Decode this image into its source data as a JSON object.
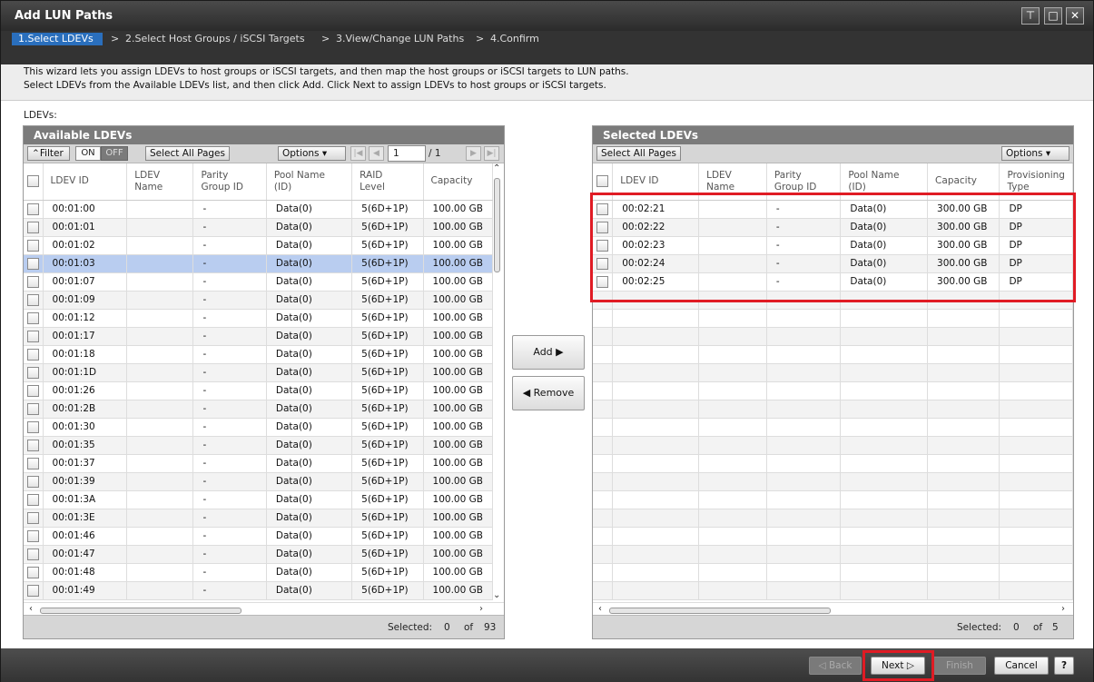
{
  "window": {
    "title": "Add LUN Paths"
  },
  "steps": [
    {
      "label": "1.Select LDEVs",
      "active": true
    },
    {
      "label": "2.Select Host Groups / iSCSI Targets"
    },
    {
      "label": "3.View/Change LUN Paths"
    },
    {
      "label": "4.Confirm"
    }
  ],
  "step_separator": ">",
  "intro": {
    "line1": "This wizard lets you assign LDEVs to host groups or iSCSI targets, and then map the host groups or iSCSI targets to LUN paths.",
    "line2": "Select LDEVs from the Available LDEVs list, and then click Add. Click Next to assign LDEVs to host groups or iSCSI targets."
  },
  "ldevs_label": "LDEVs:",
  "available": {
    "title": "Available LDEVs",
    "filter_label": "Filter",
    "toggle_on": "ON",
    "toggle_off": "OFF",
    "select_all_pages": "Select All Pages",
    "options_label": "Options",
    "page_value": "1",
    "page_total": "/ 1",
    "columns": [
      "LDEV ID",
      "LDEV\nName",
      "Parity\nGroup ID",
      "Pool Name\n(ID)",
      "RAID\nLevel",
      "Capacity"
    ],
    "rows": [
      [
        "00:01:00",
        "",
        "-",
        "Data(0)",
        "5(6D+1P)",
        "100.00 GB"
      ],
      [
        "00:01:01",
        "",
        "-",
        "Data(0)",
        "5(6D+1P)",
        "100.00 GB"
      ],
      [
        "00:01:02",
        "",
        "-",
        "Data(0)",
        "5(6D+1P)",
        "100.00 GB"
      ],
      [
        "00:01:03",
        "",
        "-",
        "Data(0)",
        "5(6D+1P)",
        "100.00 GB"
      ],
      [
        "00:01:07",
        "",
        "-",
        "Data(0)",
        "5(6D+1P)",
        "100.00 GB"
      ],
      [
        "00:01:09",
        "",
        "-",
        "Data(0)",
        "5(6D+1P)",
        "100.00 GB"
      ],
      [
        "00:01:12",
        "",
        "-",
        "Data(0)",
        "5(6D+1P)",
        "100.00 GB"
      ],
      [
        "00:01:17",
        "",
        "-",
        "Data(0)",
        "5(6D+1P)",
        "100.00 GB"
      ],
      [
        "00:01:18",
        "",
        "-",
        "Data(0)",
        "5(6D+1P)",
        "100.00 GB"
      ],
      [
        "00:01:1D",
        "",
        "-",
        "Data(0)",
        "5(6D+1P)",
        "100.00 GB"
      ],
      [
        "00:01:26",
        "",
        "-",
        "Data(0)",
        "5(6D+1P)",
        "100.00 GB"
      ],
      [
        "00:01:2B",
        "",
        "-",
        "Data(0)",
        "5(6D+1P)",
        "100.00 GB"
      ],
      [
        "00:01:30",
        "",
        "-",
        "Data(0)",
        "5(6D+1P)",
        "100.00 GB"
      ],
      [
        "00:01:35",
        "",
        "-",
        "Data(0)",
        "5(6D+1P)",
        "100.00 GB"
      ],
      [
        "00:01:37",
        "",
        "-",
        "Data(0)",
        "5(6D+1P)",
        "100.00 GB"
      ],
      [
        "00:01:39",
        "",
        "-",
        "Data(0)",
        "5(6D+1P)",
        "100.00 GB"
      ],
      [
        "00:01:3A",
        "",
        "-",
        "Data(0)",
        "5(6D+1P)",
        "100.00 GB"
      ],
      [
        "00:01:3E",
        "",
        "-",
        "Data(0)",
        "5(6D+1P)",
        "100.00 GB"
      ],
      [
        "00:01:46",
        "",
        "-",
        "Data(0)",
        "5(6D+1P)",
        "100.00 GB"
      ],
      [
        "00:01:47",
        "",
        "-",
        "Data(0)",
        "5(6D+1P)",
        "100.00 GB"
      ],
      [
        "00:01:48",
        "",
        "-",
        "Data(0)",
        "5(6D+1P)",
        "100.00 GB"
      ],
      [
        "00:01:49",
        "",
        "-",
        "Data(0)",
        "5(6D+1P)",
        "100.00 GB"
      ]
    ],
    "selected_row_index": 3,
    "footer_selected_label": "Selected:",
    "footer_selected_count": "0",
    "footer_of": "of",
    "footer_total": "93"
  },
  "buttons": {
    "add": "Add",
    "remove": "Remove"
  },
  "selected": {
    "title": "Selected LDEVs",
    "select_all_pages": "Select All Pages",
    "options_label": "Options",
    "columns": [
      "LDEV ID",
      "LDEV\nName",
      "Parity\nGroup ID",
      "Pool Name\n(ID)",
      "Capacity",
      "Provisioning\nType"
    ],
    "rows": [
      [
        "00:02:21",
        "",
        "-",
        "Data(0)",
        "300.00 GB",
        "DP"
      ],
      [
        "00:02:22",
        "",
        "-",
        "Data(0)",
        "300.00 GB",
        "DP"
      ],
      [
        "00:02:23",
        "",
        "-",
        "Data(0)",
        "300.00 GB",
        "DP"
      ],
      [
        "00:02:24",
        "",
        "-",
        "Data(0)",
        "300.00 GB",
        "DP"
      ],
      [
        "00:02:25",
        "",
        "-",
        "Data(0)",
        "300.00 GB",
        "DP"
      ]
    ],
    "empty_rows": 17,
    "footer_selected_label": "Selected:",
    "footer_selected_count": "0",
    "footer_of": "of",
    "footer_total": "5"
  },
  "footer": {
    "back": "Back",
    "next": "Next",
    "finish": "Finish",
    "cancel": "Cancel",
    "help": "?"
  },
  "colors": {
    "highlight": "#e01b24",
    "active_step": "#2a6fbd",
    "selected_row": "#b9cdf0"
  }
}
